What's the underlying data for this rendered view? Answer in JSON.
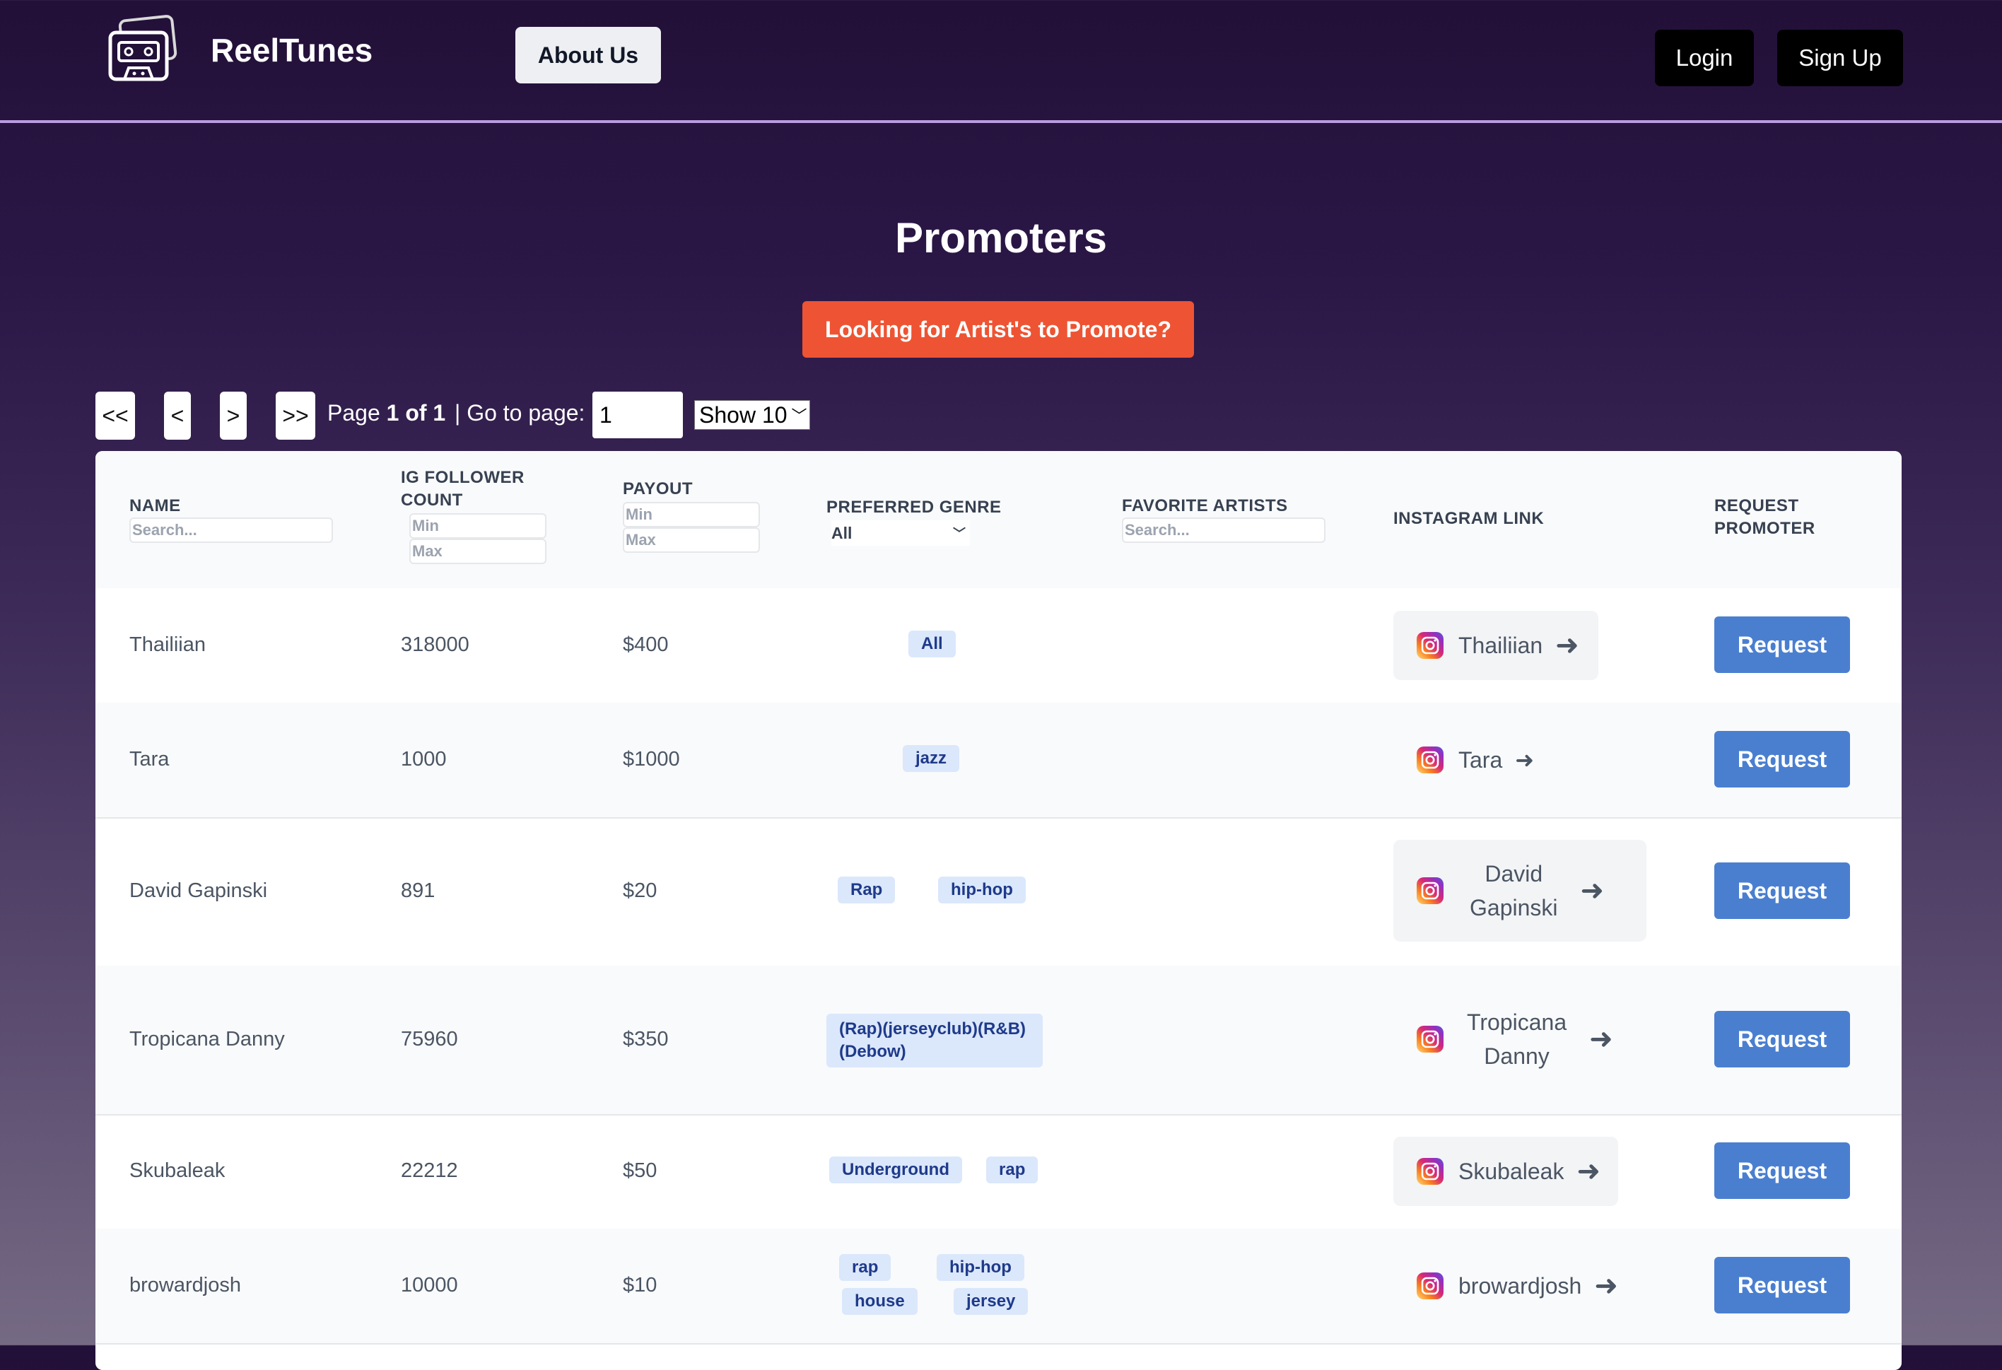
{
  "header": {
    "brand": "ReelTunes",
    "about_label": "About Us",
    "login_label": "Login",
    "signup_label": "Sign Up"
  },
  "main": {
    "title": "Promoters",
    "cta_label": "Looking for Artist's to Promote?"
  },
  "pagination": {
    "first": "<<",
    "prev": "<",
    "next": ">",
    "last": ">>",
    "page_prefix": "Page",
    "page_of": "1 of 1",
    "goto_label": "| Go to page:",
    "goto_value": "1",
    "show_value": "Show 10"
  },
  "table": {
    "columns": {
      "name": "NAME",
      "followers_1": "IG FOLLOWER",
      "followers_2": "COUNT",
      "payout": "PAYOUT",
      "genre": "PREFERRED GENRE",
      "artists": "FAVORITE ARTISTS",
      "instagram": "INSTAGRAM LINK",
      "request_1": "REQUEST",
      "request_2": "PROMOTER"
    },
    "filters": {
      "search_placeholder": "Search...",
      "min_placeholder": "Min",
      "max_placeholder": "Max",
      "genre_value": "All"
    },
    "request_label": "Request",
    "rows": [
      {
        "name": "Thailiian",
        "followers": "318000",
        "payout": "$400",
        "genres": [
          "All"
        ],
        "ig": "Thailiian"
      },
      {
        "name": "Tara",
        "followers": "1000",
        "payout": "$1000",
        "genres": [
          "jazz"
        ],
        "ig": "Tara"
      },
      {
        "name": "David Gapinski",
        "followers": "891",
        "payout": "$20",
        "genres": [
          "Rap",
          "hip-hop"
        ],
        "ig_1": "David",
        "ig_2": "Gapinski"
      },
      {
        "name": "Tropicana Danny",
        "followers": "75960",
        "payout": "$350",
        "genres": [
          "(Rap)(jerseyclub)(R&B)",
          "(Debow)"
        ],
        "ig_1": "Tropicana",
        "ig_2": "Danny"
      },
      {
        "name": "Skubaleak",
        "followers": "22212",
        "payout": "$50",
        "genres": [
          "Underground",
          "rap"
        ],
        "ig": "Skubaleak"
      },
      {
        "name": "browardjosh",
        "followers": "10000",
        "payout": "$10",
        "genres": [
          "rap",
          "hip-hop",
          "house",
          "jersey"
        ],
        "ig": "browardjosh"
      }
    ]
  },
  "icons": {
    "logo": "cassette-tape-icon",
    "instagram": "instagram-icon",
    "arrow": "arrow-right-icon",
    "chevron": "chevron-down-icon"
  },
  "colors": {
    "cta": "#ee5433",
    "request": "#4a7fd0",
    "tag_bg": "#dbe7fb",
    "tag_text": "#1e3a8a"
  }
}
